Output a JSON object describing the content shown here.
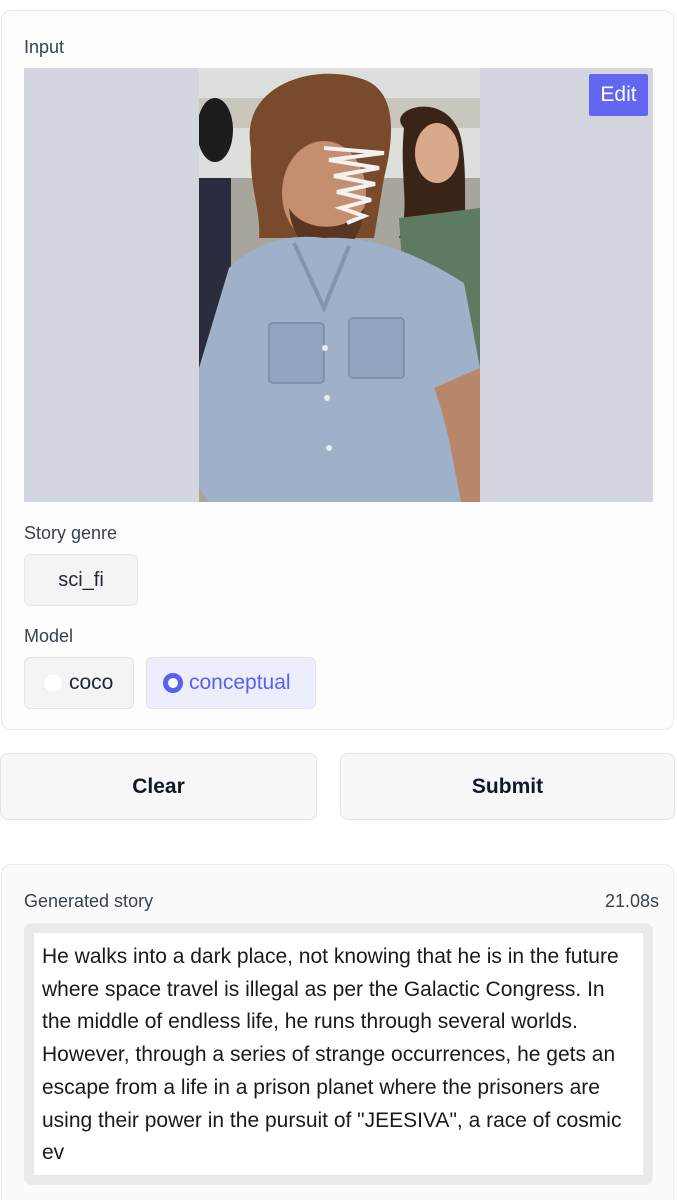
{
  "input_panel": {
    "label": "Input",
    "edit_label": "Edit",
    "genre_label": "Story genre",
    "genre_value": "sci_fi",
    "model_label": "Model",
    "model_options": [
      "coco",
      "conceptual"
    ],
    "model_selected": "conceptual"
  },
  "actions": {
    "clear_label": "Clear",
    "submit_label": "Submit"
  },
  "output_panel": {
    "label": "Generated story",
    "timer": "21.08s",
    "story": "He walks into a dark place, not knowing that he is in the future where space travel is illegal as per the Galactic Congress. In the middle of endless life, he runs through several worlds. However, through a series of strange occurrences, he gets an escape from a life in a prison planet where the prisoners are using their power in the pursuit of \"JEESIVA\", a race of cosmic ev"
  },
  "colors": {
    "accent": "#6366f1",
    "image_background": "#d4d6df"
  }
}
